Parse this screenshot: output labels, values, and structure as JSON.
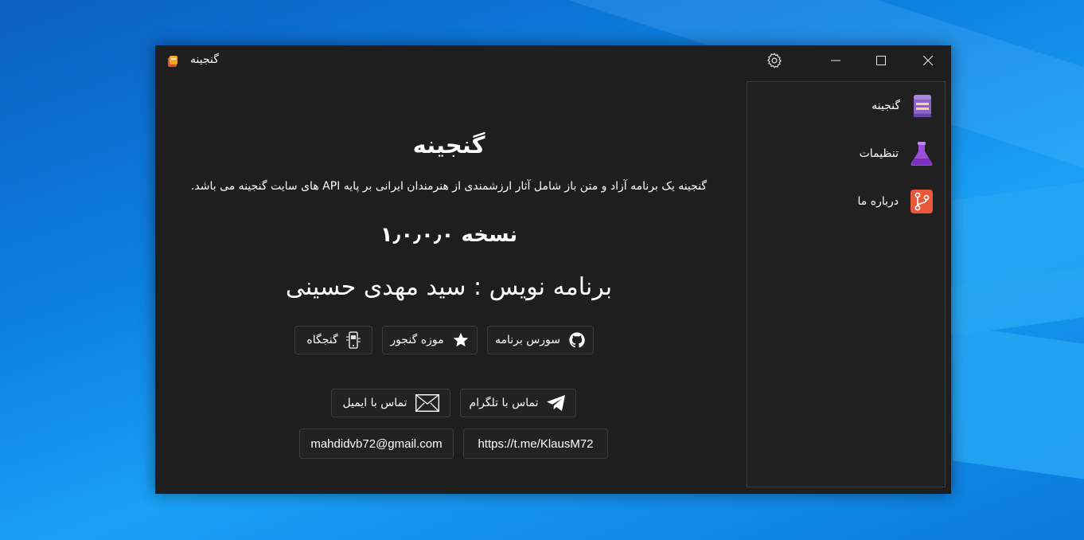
{
  "window": {
    "title": "گنجینه"
  },
  "titlebar": {
    "settings_icon": "gear-icon",
    "minimize_icon": "minimize-icon",
    "maximize_icon": "maximize-icon",
    "close_icon": "close-icon"
  },
  "about": {
    "app_name": "گنجینه",
    "description": "گنجینه یک برنامه آزاد و متن باز شامل آثار ارزشمندی از هنرمندان ایرانی بر پایه API های سایت گنجینه می باشد.",
    "version": "نسخه ۱٫۰٫۰٫۰",
    "author": "برنامه نویس : سید مهدی حسینی",
    "buttons": {
      "source": "سورس برنامه",
      "museum": "موزه گنجور",
      "ganjgah": "گنجگاه"
    },
    "contact": {
      "telegram_label": "تماس با تلگرام",
      "email_label": "تماس با ایمیل",
      "telegram_link": "https://t.me/KlausM72",
      "email_link": "mahdidvb72@gmail.com"
    }
  },
  "nav": {
    "items": [
      {
        "label": "گنجینه",
        "icon": "book-icon"
      },
      {
        "label": "تنظیمات",
        "icon": "flask-icon"
      },
      {
        "label": "درباره ما",
        "icon": "git-branch-icon"
      }
    ]
  },
  "colors": {
    "window_bg": "#1e1e1e",
    "nav_bg": "#202020",
    "book": "#8a63c9",
    "flask": "#9b4fd9",
    "git": "#e8583a"
  }
}
